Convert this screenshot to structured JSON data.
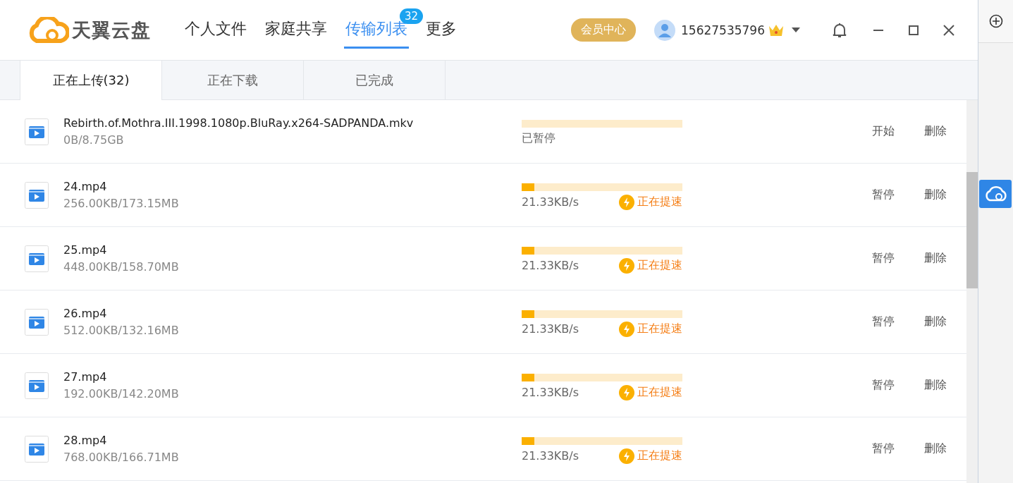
{
  "header": {
    "logo_text": "天翼云盘",
    "nav": [
      {
        "label": "个人文件",
        "selected": false
      },
      {
        "label": "家庭共享",
        "selected": false
      },
      {
        "label": "传输列表",
        "selected": true,
        "badge": "32"
      },
      {
        "label": "更多",
        "selected": false
      }
    ],
    "member_button": "会员中心",
    "user": "15627535796"
  },
  "tabs": [
    {
      "label": "正在上传(32)",
      "selected": true
    },
    {
      "label": "正在下载",
      "selected": false
    },
    {
      "label": "已完成",
      "selected": false
    }
  ],
  "rows": [
    {
      "name": "Rebirth.of.Mothra.III.1998.1080p.BluRay.x264-SADPANDA.mkv",
      "size": "0B/8.75GB",
      "level": 0,
      "status": "已暂停",
      "actions": [
        "开始",
        "删除"
      ]
    },
    {
      "name": "24.mp4",
      "size": "256.00KB/173.15MB",
      "level": 0.08,
      "status": "21.33KB/s",
      "boost": "正在提速",
      "actions": [
        "暂停",
        "删除"
      ]
    },
    {
      "name": "25.mp4",
      "size": "448.00KB/158.70MB",
      "level": 0.08,
      "status": "21.33KB/s",
      "boost": "正在提速",
      "actions": [
        "暂停",
        "删除"
      ]
    },
    {
      "name": "26.mp4",
      "size": "512.00KB/132.16MB",
      "level": 0.08,
      "status": "21.33KB/s",
      "boost": "正在提速",
      "actions": [
        "暂停",
        "删除"
      ]
    },
    {
      "name": "27.mp4",
      "size": "192.00KB/142.20MB",
      "level": 0.08,
      "status": "21.33KB/s",
      "boost": "正在提速",
      "actions": [
        "暂停",
        "删除"
      ]
    },
    {
      "name": "28.mp4",
      "size": "768.00KB/166.71MB",
      "level": 0.08,
      "status": "21.33KB/s",
      "boost": "正在提速",
      "actions": [
        "暂停",
        "删除"
      ]
    }
  ]
}
